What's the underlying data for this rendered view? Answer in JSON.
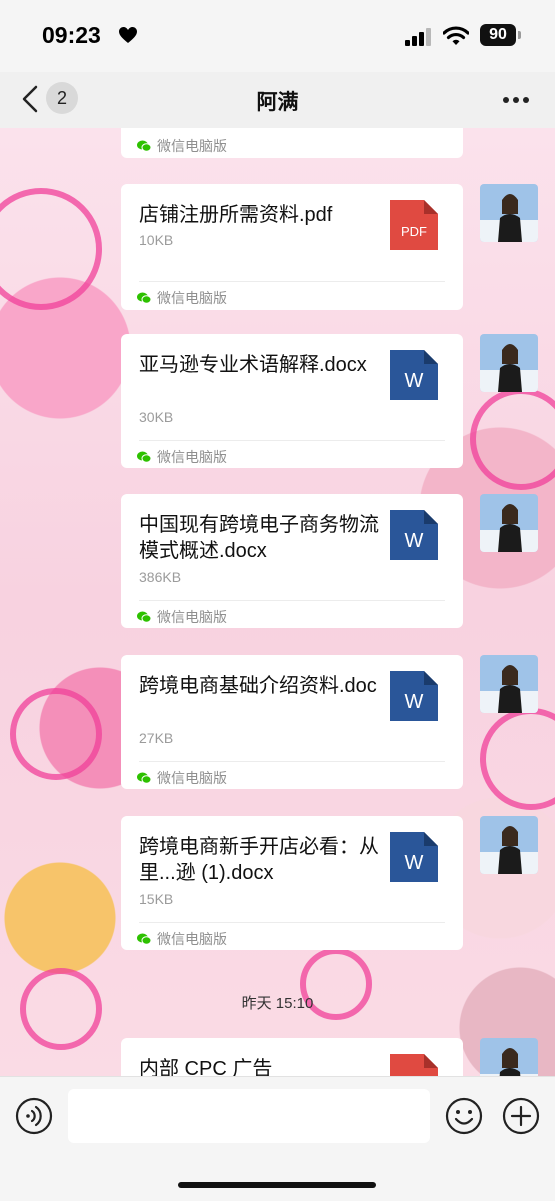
{
  "status": {
    "time": "09:23",
    "battery": "90"
  },
  "nav": {
    "back_count": "2",
    "title": "阿满"
  },
  "messages": [
    {
      "source": "微信电脑版"
    },
    {
      "file": "店铺注册所需资料.pdf",
      "size": "10KB",
      "icon": "PDF",
      "source": "微信电脑版"
    },
    {
      "file": "亚马逊专业术语解释.docx",
      "size": "30KB",
      "icon": "W",
      "source": "微信电脑版"
    },
    {
      "file": "中国现有跨境电子商务物流模式概述.docx",
      "size": "386KB",
      "icon": "W",
      "source": "微信电脑版"
    },
    {
      "file": "跨境电商基础介绍资料.doc",
      "size": "27KB",
      "icon": "W",
      "source": "微信电脑版"
    },
    {
      "file": "跨境电商新手开店必看：从里...逊 (1).docx",
      "size": "15KB",
      "icon": "W",
      "source": "微信电脑版"
    },
    {
      "file": "内部 CPC 广告"
    }
  ],
  "timestamp": "昨天 15:10",
  "colors": {
    "pdf": "#e04a41",
    "word": "#2a5699",
    "wechat_green": "#2dc100",
    "accent_pink": "#f0409a"
  }
}
